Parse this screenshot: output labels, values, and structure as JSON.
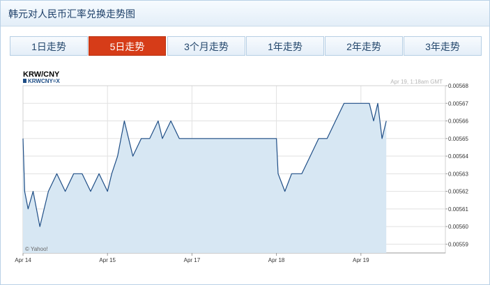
{
  "header": {
    "title": "韩元对人民币汇率兑换走势图"
  },
  "tabs": [
    {
      "label": "1日走势",
      "active": false
    },
    {
      "label": "5日走势",
      "active": true
    },
    {
      "label": "3个月走势",
      "active": false
    },
    {
      "label": "1年走势",
      "active": false
    },
    {
      "label": "2年走势",
      "active": false
    },
    {
      "label": "3年走势",
      "active": false
    }
  ],
  "colors": {
    "accent": "#d63c18",
    "line": "#1f4e86",
    "area": "#d7e7f3",
    "grid": "#e1e1e1"
  },
  "chart_data": {
    "type": "area",
    "title": "KRW/CNY",
    "legend": "KRWCNY=X",
    "timestamp": "Apr 19, 1:18am GMT",
    "watermark": "© Yahoo!",
    "grid": true,
    "x_ticks": [
      "Apr 14",
      "Apr 15",
      "Apr 17",
      "Apr 18",
      "Apr 19"
    ],
    "y_ticks": [
      "0.00568",
      "0.00567",
      "0.00566",
      "0.00565",
      "0.00564",
      "0.00563",
      "0.00562",
      "0.00561",
      "0.00560",
      "0.00559"
    ],
    "ylim": [
      0.005585,
      0.00568
    ],
    "xlim": [
      0,
      5
    ],
    "x": [
      0,
      0.02,
      0.06,
      0.12,
      0.2,
      0.3,
      0.4,
      0.5,
      0.6,
      0.7,
      0.8,
      0.9,
      1.0,
      1.05,
      1.12,
      1.2,
      1.25,
      1.3,
      1.4,
      1.5,
      1.6,
      1.65,
      1.75,
      1.85,
      1.88,
      2.0,
      2.5,
      3.0,
      3.02,
      3.1,
      3.18,
      3.3,
      3.4,
      3.5,
      3.6,
      3.7,
      3.8,
      3.9,
      4.0,
      4.05,
      4.1,
      4.15,
      4.2,
      4.25,
      4.3
    ],
    "values": [
      0.00565,
      0.00562,
      0.00561,
      0.00562,
      0.0056,
      0.00562,
      0.00563,
      0.00562,
      0.00563,
      0.00563,
      0.00562,
      0.00563,
      0.00562,
      0.00563,
      0.00564,
      0.00566,
      0.00565,
      0.00564,
      0.00565,
      0.00565,
      0.00566,
      0.00565,
      0.00566,
      0.00565,
      0.00565,
      0.00565,
      0.00565,
      0.00565,
      0.00563,
      0.00562,
      0.00563,
      0.00563,
      0.00564,
      0.00565,
      0.00565,
      0.00566,
      0.00567,
      0.00567,
      0.00567,
      0.00567,
      0.00567,
      0.00566,
      0.00567,
      0.00565,
      0.00566
    ]
  }
}
